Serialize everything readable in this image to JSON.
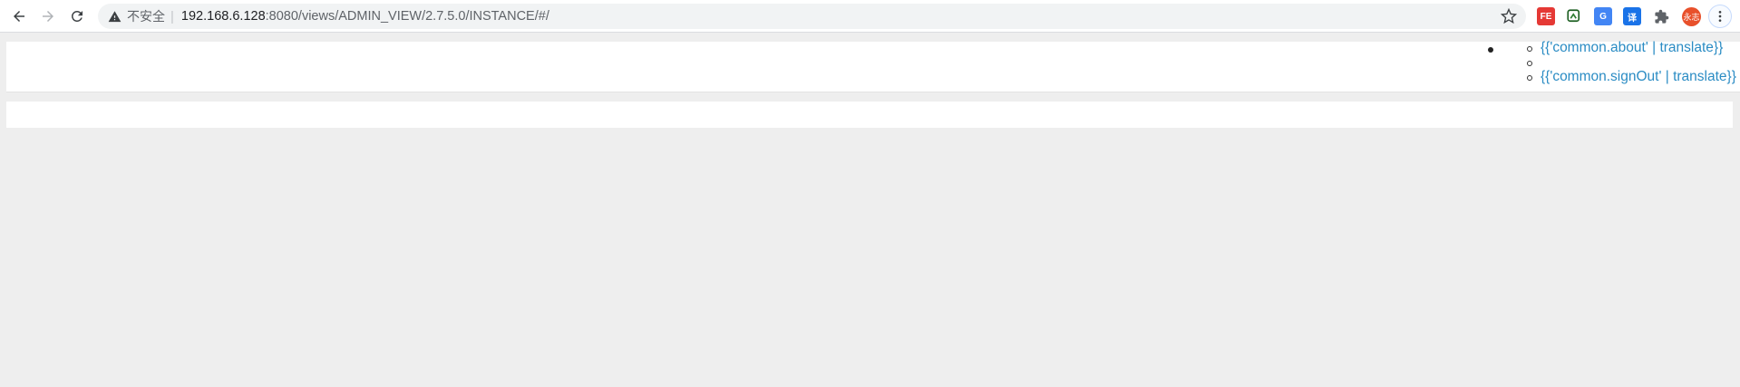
{
  "browser": {
    "security_label": "不安全",
    "url_host": "192.168.6.128",
    "url_rest": ":8080/views/ADMIN_VIEW/2.7.5.0/INSTANCE/#/",
    "avatar_text": "永志",
    "icons": {
      "back": "arrow-left-icon",
      "forward": "arrow-right-icon",
      "reload": "reload-icon",
      "warning": "warning-triangle-icon",
      "bookmark": "star-icon",
      "extensions": "puzzle-icon",
      "menu": "kebab-menu-icon"
    },
    "extensions": [
      {
        "label": "FE",
        "color": "#e53935"
      },
      {
        "label": "",
        "color": "#2e7d32"
      },
      {
        "label": "G",
        "color": "#4285f4"
      },
      {
        "label": "译",
        "color": "#1a73e8"
      }
    ]
  },
  "page": {
    "nav_links": [
      {
        "label": "{{'common.about' | translate}}"
      },
      {
        "label": ""
      },
      {
        "label": "{{'common.signOut' | translate}}"
      }
    ],
    "link_color": "#2b8cc4",
    "background_color": "#eeeeee"
  }
}
